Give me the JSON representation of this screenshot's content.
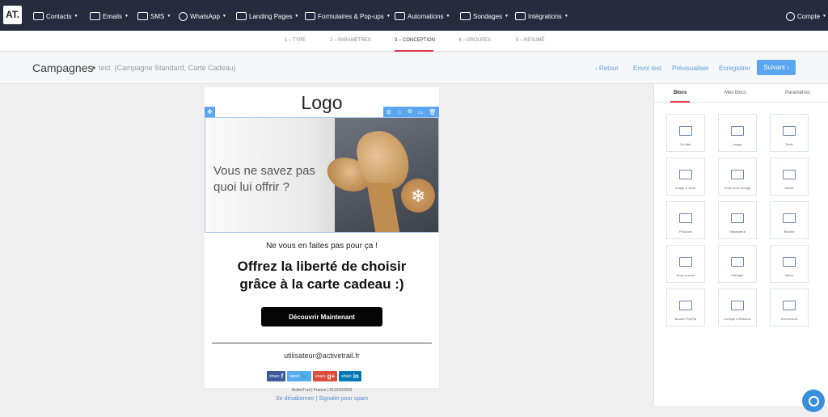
{
  "nav": {
    "logo": "AT.",
    "items": [
      {
        "label": "Contacts",
        "icon": "contacts-icon"
      },
      {
        "label": "Emails",
        "icon": "email-icon"
      },
      {
        "label": "SMS",
        "icon": "sms-icon"
      },
      {
        "label": "WhatsApp",
        "icon": "whatsapp-icon"
      },
      {
        "label": "Landing Pages",
        "icon": "landing-pages-icon"
      },
      {
        "label": "Formulaires & Pop-ups",
        "icon": "forms-icon"
      },
      {
        "label": "Automations",
        "icon": "automations-icon"
      },
      {
        "label": "Sondages",
        "icon": "surveys-icon"
      },
      {
        "label": "Intégrations",
        "icon": "integrations-icon"
      }
    ],
    "account": "Compte"
  },
  "steps": [
    "1 – TYPE",
    "2 – PARAMÈTRES",
    "3 – CONCEPTION",
    "4 – GROUPES",
    "5 – RÉSUMÉ"
  ],
  "header": {
    "title": "Campagnes",
    "dot": "•",
    "name": "test",
    "subtitle": "(Campagne Standard, Carte Cadeau)",
    "back": "‹ Retour",
    "test_send": "Envoi test",
    "preview": "Prévisualiser",
    "save": "Enregistrer",
    "next": "Suivant ›"
  },
  "email": {
    "logo": "Logo",
    "hero_line1": "Vous ne savez pas",
    "hero_line2": "quoi lui offrir ?",
    "subheading": "Ne vous en faites pas pour ça !",
    "headline_line1": "Offrez la liberté de choisir",
    "headline_line2": "grâce à la carte cadeau :)",
    "cta": "Découvrir Maintenant",
    "address": "utilisateur@activetrail.fr",
    "share": [
      {
        "label": "share",
        "glyph": "f",
        "color": "#3b5998"
      },
      {
        "label": "tweet",
        "glyph": "🐦",
        "color": "#55acee"
      },
      {
        "label": "share",
        "glyph": "g+",
        "color": "#dd4b39"
      },
      {
        "label": "share",
        "glyph": "in",
        "color": "#0077b5"
      }
    ],
    "footer_info": "ActiveTrail | France | 0122332233",
    "footer_links": "Se désabonner | Signaler pour spam"
  },
  "panel": {
    "tabs": [
      "Blocs",
      "Mes blocs",
      "Paramètres"
    ],
    "blocks": [
      "En-tête",
      "Image",
      "Texte",
      "Image & Texte",
      "Texte sous l'image",
      "Article",
      "Products",
      "Séparateur",
      "Bouton",
      "Nous trouver",
      "Partager",
      "Menu",
      "Bouton PayPal",
      "Compte à Rebours",
      "Événement"
    ]
  },
  "colors": {
    "nav_bg": "#262b3d",
    "accent": "#5aa6f0",
    "active_tab": "#e03a4e"
  }
}
